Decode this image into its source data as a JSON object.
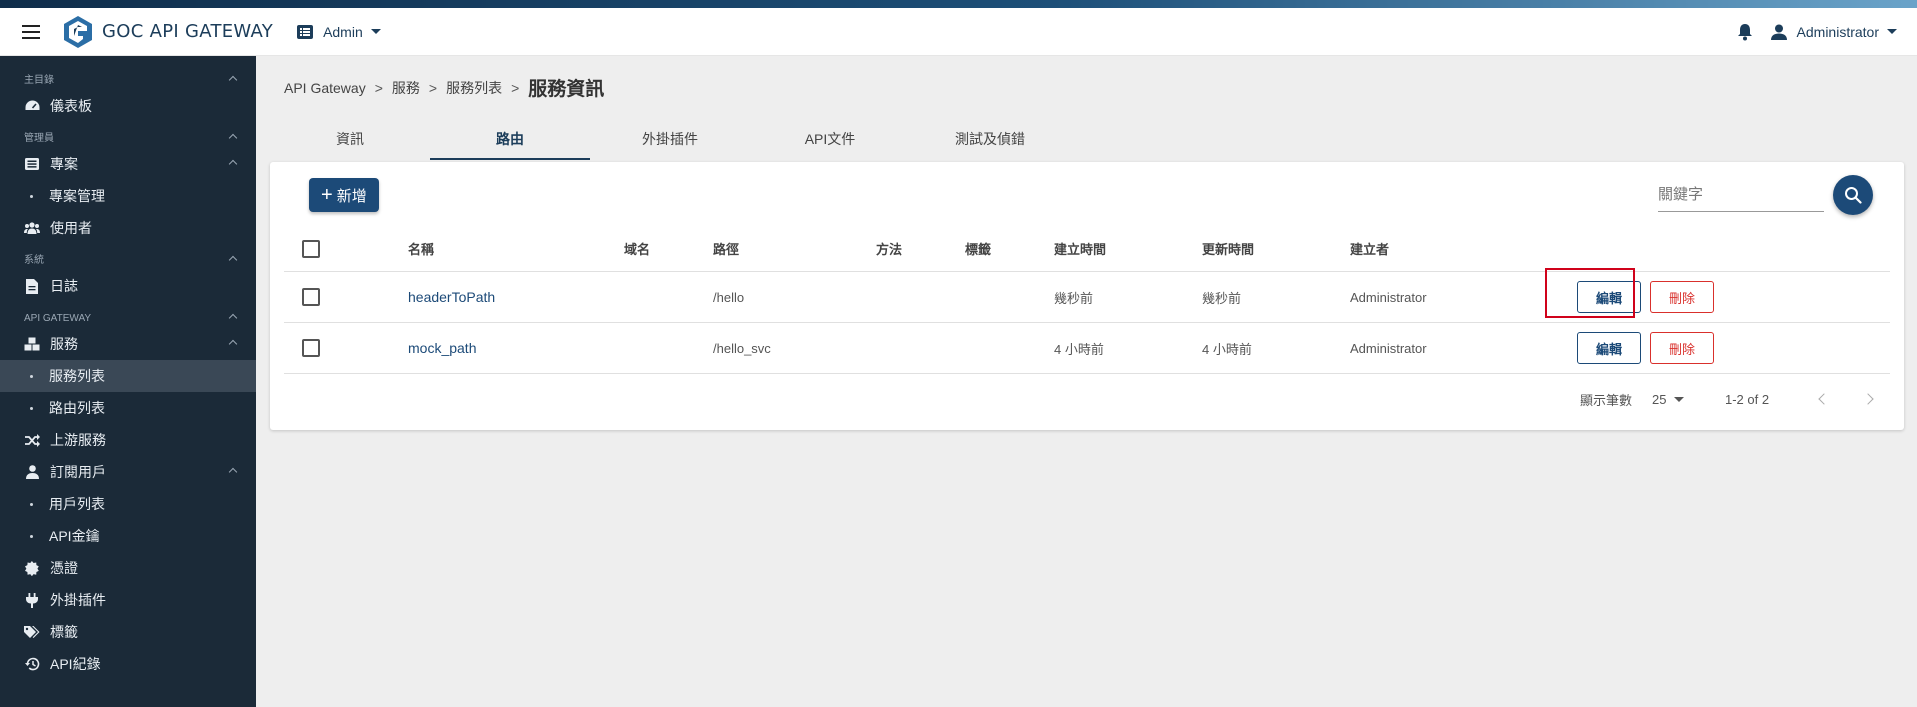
{
  "app": {
    "title": "GOC API GATEWAY",
    "context_switch": "Admin",
    "user": "Administrator",
    "accent": "#1c4a78",
    "danger": "#d9302c"
  },
  "sidebar": {
    "sections": {
      "main": "主目錄",
      "admin": "管理員",
      "system": "系統",
      "gateway": "API GATEWAY"
    },
    "items": {
      "dashboard": "儀表板",
      "projects": "專案",
      "project_mgmt": "專案管理",
      "users": "使用者",
      "logs": "日誌",
      "services": "服務",
      "service_list": "服務列表",
      "route_list": "路由列表",
      "upstream": "上游服務",
      "subscribers": "訂閱用戶",
      "user_list": "用戶列表",
      "api_keys": "API金鑰",
      "certs": "憑證",
      "plugins": "外掛插件",
      "tags": "標籤",
      "api_records": "API紀錄"
    }
  },
  "breadcrumb": [
    "API Gateway",
    "服務",
    "服務列表",
    "服務資訊"
  ],
  "breadcrumb_sep": ">",
  "tabs": [
    "資訊",
    "路由",
    "外掛插件",
    "API文件",
    "測試及偵錯"
  ],
  "toolbar": {
    "add_label": "新增",
    "search_placeholder": "關鍵字"
  },
  "table": {
    "headers": {
      "name": "名稱",
      "domain": "域名",
      "path": "路徑",
      "method": "方法",
      "tags": "標籤",
      "created": "建立時間",
      "updated": "更新時間",
      "creator": "建立者"
    },
    "rows": [
      {
        "name": "headerToPath",
        "domain": "",
        "path": "/hello",
        "method": "",
        "tags": "",
        "created": "幾秒前",
        "updated": "幾秒前",
        "creator": "Administrator",
        "edit": "編輯",
        "delete": "刪除"
      },
      {
        "name": "mock_path",
        "domain": "",
        "path": "/hello_svc",
        "method": "",
        "tags": "",
        "created": "4 小時前",
        "updated": "4 小時前",
        "creator": "Administrator",
        "edit": "編輯",
        "delete": "刪除"
      }
    ]
  },
  "pagination": {
    "rows_label": "顯示筆數",
    "rows_value": "25",
    "range": "1-2 of 2"
  }
}
